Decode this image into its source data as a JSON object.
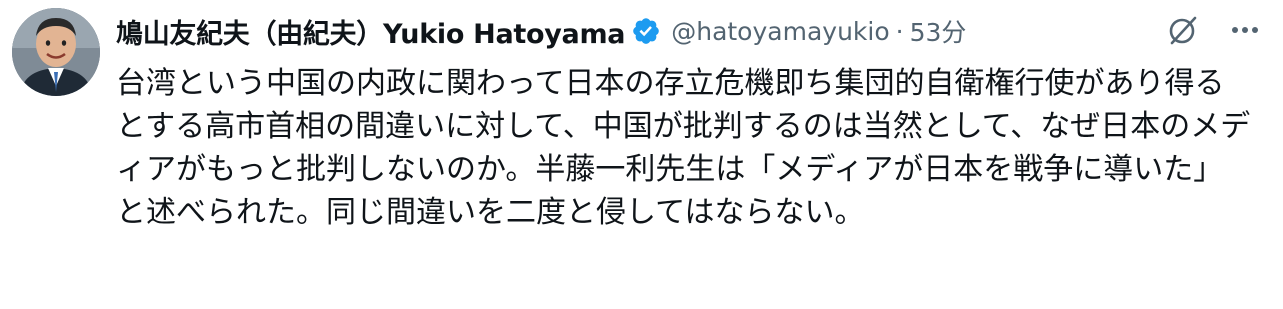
{
  "tweet": {
    "author": {
      "display_name": "鳩山友紀夫（由紀夫）Yukio Hatoyama",
      "handle": "@hatoyamayukio",
      "verified": true,
      "avatar": "avatar-photo"
    },
    "separator": "·",
    "timestamp": "53分",
    "text": "台湾という中国の内政に関わって日本の存立危機即ち集団的自衛権行使があり得るとする高市首相の間違いに対して、中国が批判するのは当然として、なぜ日本のメディアがもっと批判しないのか。半藤一利先生は「メディアが日本を戦争に導いた」と述べられた。同じ間違いを二度と侵してはならない。",
    "icons": {
      "verified": "verified-badge-icon",
      "grok": "grok-icon",
      "more": "more-icon"
    },
    "colors": {
      "verified_blue": "#1d9bf0",
      "secondary_text": "#536471",
      "primary_text": "#0f1419"
    }
  }
}
